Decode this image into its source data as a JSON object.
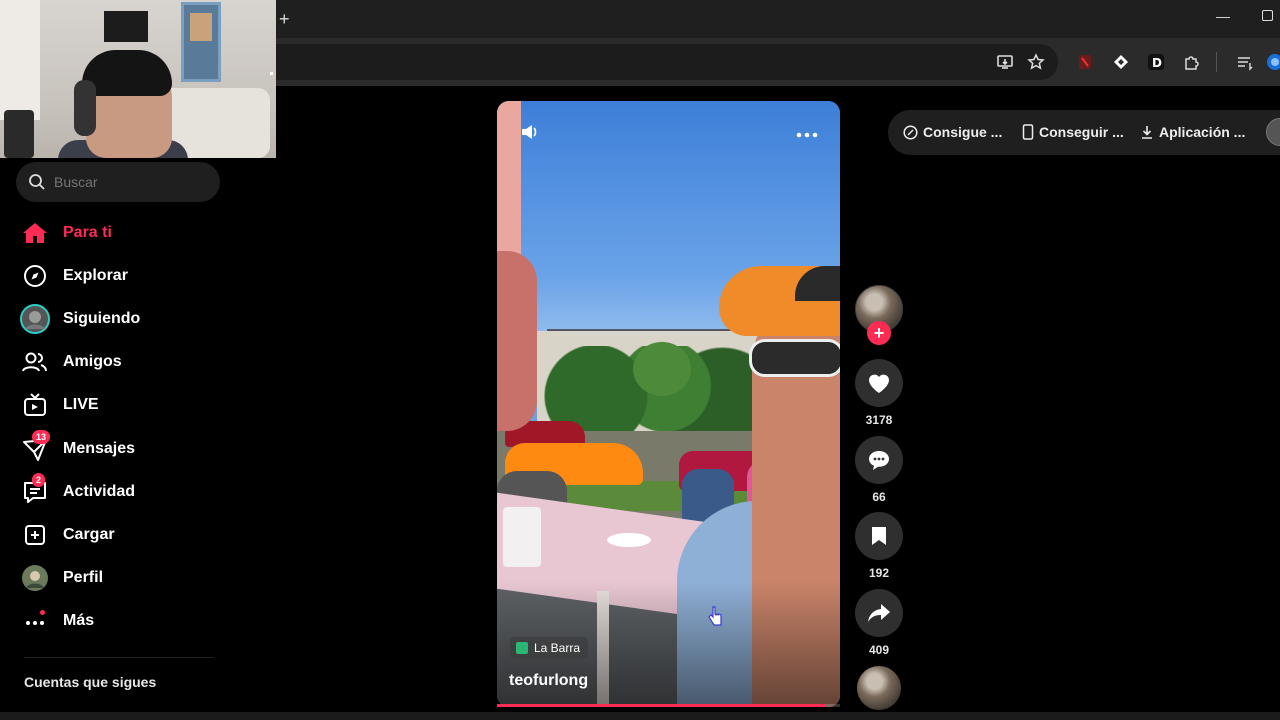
{
  "browser": {
    "new_tab_symbol": "+",
    "minimize_symbol": "—",
    "toolbar_icons": [
      "install-app-icon",
      "star-icon",
      "extension-red-icon",
      "extension-diamond-icon",
      "extension-d-icon",
      "puzzle-icon",
      "reading-list-icon",
      "profile-icon"
    ]
  },
  "search": {
    "placeholder": "Buscar"
  },
  "sidebar": {
    "items": [
      {
        "label": "Para ti",
        "icon": "home-icon",
        "active": true
      },
      {
        "label": "Explorar",
        "icon": "compass-icon"
      },
      {
        "label": "Siguiendo",
        "icon": "following-avatar-icon"
      },
      {
        "label": "Amigos",
        "icon": "friends-icon"
      },
      {
        "label": "LIVE",
        "icon": "live-tv-icon"
      },
      {
        "label": "Mensajes",
        "icon": "messages-icon",
        "badge": "13"
      },
      {
        "label": "Actividad",
        "icon": "activity-icon",
        "badge": "2"
      },
      {
        "label": "Cargar",
        "icon": "upload-icon"
      },
      {
        "label": "Perfil",
        "icon": "profile-avatar-icon"
      },
      {
        "label": "Más",
        "icon": "more-dots-icon"
      }
    ],
    "following_section_title": "Cuentas que sigues"
  },
  "video": {
    "location": "La Barra",
    "username": "teofurlong",
    "progress_fraction": 0.96
  },
  "actions": {
    "likes": "3178",
    "comments": "66",
    "saves": "192",
    "shares": "409",
    "follow_symbol": "+"
  },
  "topbar": {
    "pills": [
      "Consigue ...",
      "Conseguir ...",
      "Aplicación ..."
    ]
  },
  "colors": {
    "accent": "#fe2c55",
    "background": "#000000",
    "rail_button": "#2f2f2f"
  }
}
